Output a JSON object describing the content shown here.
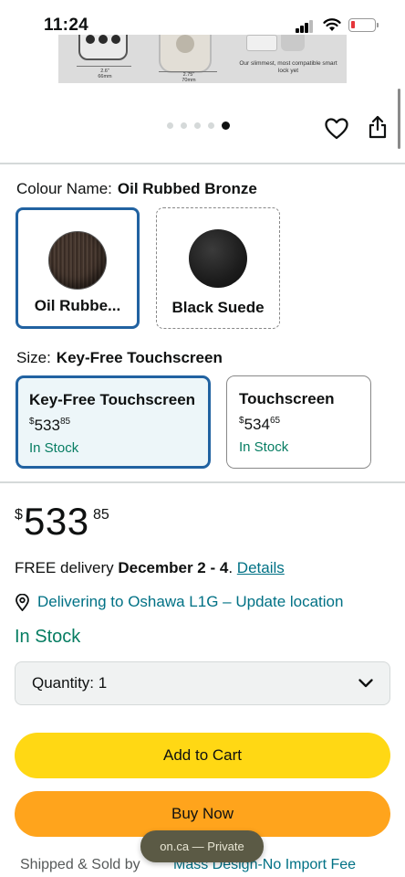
{
  "status_bar": {
    "time": "11:24",
    "battery_color": "#e5363b"
  },
  "image_strip": {
    "dim1": "2.6\"",
    "dim1_sub": "66mm",
    "dim2": "2.75\"",
    "dim2_sub": "70mm",
    "caption": "Our slimmest, most compatible smart lock yet"
  },
  "carousel": {
    "total_dots": 5,
    "active_index": 4
  },
  "icons": {
    "favorite": "heart-icon",
    "share": "share-icon",
    "location": "location-pin-icon",
    "dropdown": "chevron-down-icon"
  },
  "colour": {
    "label": "Colour Name:",
    "selected": "Oil Rubbed Bronze",
    "options": [
      {
        "name": "Oil Rubbe...",
        "state": "selected"
      },
      {
        "name": "Black Suede",
        "state": "unavailable"
      }
    ]
  },
  "size": {
    "label": "Size:",
    "selected": "Key-Free Touchscreen",
    "options": [
      {
        "title": "Key-Free Touchscreen",
        "currency": "$",
        "whole": "533",
        "fraction": "85",
        "stock": "In Stock"
      },
      {
        "title": "Touchscreen",
        "currency": "$",
        "whole": "534",
        "fraction": "65",
        "stock": "In Stock"
      }
    ]
  },
  "price": {
    "currency": "$",
    "whole": "533",
    "fraction": "85"
  },
  "delivery": {
    "prefix": "FREE delivery",
    "dates": "December 2 - 4",
    "suffix": ".",
    "link": "Details"
  },
  "location": {
    "text": "Delivering to Oshawa L1G – Update location"
  },
  "availability": "In Stock",
  "quantity": {
    "label": "Quantity:",
    "value": "1"
  },
  "buttons": {
    "add_to_cart": "Add to Cart",
    "buy_now": "Buy Now"
  },
  "browser_pill": "on.ca — Private",
  "shipping": {
    "label": "Shipped & Sold by",
    "seller": "Mass Design-No Import Fee"
  },
  "colors": {
    "accent_blue": "#2162a1",
    "link": "#007185",
    "stock_green": "#067d62",
    "cart_yellow": "#ffd814",
    "buy_orange": "#ffa41c"
  }
}
